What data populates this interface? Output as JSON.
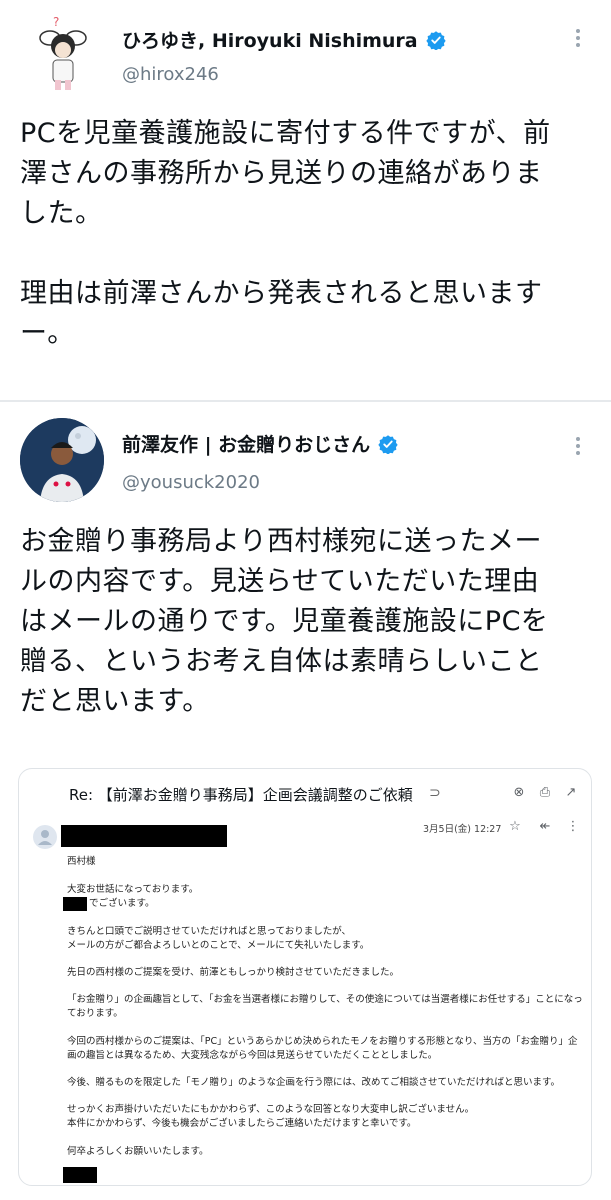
{
  "tweets": [
    {
      "name": "ひろゆき, Hiroyuki Nishimura",
      "handle": "@hirox246",
      "text": "PCを児童養護施設に寄付する件ですが、前\n澤さんの事務所から見送りの連絡がありま\nした。\n\n理由は前澤さんから発表されると思いますー。"
    },
    {
      "name": "前澤友作 | お金贈りおじさん",
      "handle": "@yousuck2020",
      "text": "お金贈り事務局より西村様宛に送ったメー\nルの内容です。見送らせていただいた理由\nはメールの通りです。児童養護施設にPCを\n贈る、というお考え自体は素晴らしいこと\nだと思います。"
    }
  ],
  "email": {
    "subject": "Re: 【前澤お金贈り事務局】企画会議調整のご依頼",
    "tag": "⊃",
    "date": "3月5日(金) 12:27",
    "greeting": "西村様",
    "lines": [
      "大変お世話になっております。",
      "でございます。",
      "きちんと口頭でご説明させていただければと思っておりましたが、",
      "メールの方がご都合よろしいとのことで、メールにて失礼いたします。",
      "先日の西村様のご提案を受け、前澤ともしっかり検討させていただきました。",
      "「お金贈り」の企画趣旨として、「お金を当選者様にお贈りして、その使途については当選者様にお任せする」ことになっ",
      "ております。",
      "今回の西村様からのご提案は、「PC」というあらかじめ決められたモノをお贈りする形態となり、当方の「お金贈り」企",
      "画の趣旨とは異なるため、大変残念ながら今回は見送らせていただくこととしました。",
      "今後、贈るものを限定した「モノ贈り」のような企画を行う際には、改めてご相談させていただければと思います。",
      "せっかくお声掛けいただいたにもかかわらず、このような回答となり大変申し訳ございません。",
      "本件にかかわらず、今後も機会がございましたらご連絡いただけますと幸いです。",
      "何卒よろしくお願いいたします。"
    ]
  },
  "colors": {
    "verified": "#1d9bf0",
    "handle": "#6c7a86",
    "separator": "#e6e9ec"
  },
  "icons": [
    "verified-badge-icon",
    "more-options-icon",
    "close-icon",
    "print-icon",
    "open-external-icon",
    "star-icon",
    "reply-all-icon",
    "person-icon"
  ]
}
